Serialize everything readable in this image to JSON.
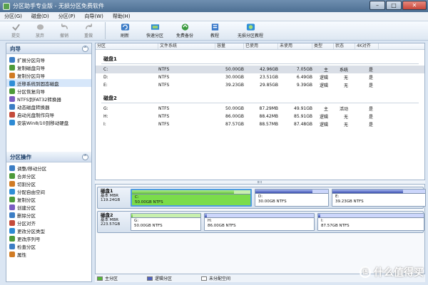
{
  "window": {
    "title": "分区助手专业版 - 无损分区免费软件"
  },
  "menu": [
    "分区(G)",
    "磁盘(D)",
    "分区(P)",
    "向导(W)",
    "帮助(H)"
  ],
  "toolbar": [
    {
      "label": "提交",
      "icon": "check-icon",
      "enabled": false
    },
    {
      "label": "放弃",
      "icon": "discard-icon",
      "enabled": false
    },
    {
      "label": "撤销",
      "icon": "undo-icon",
      "enabled": false
    },
    {
      "label": "重做",
      "icon": "redo-icon",
      "enabled": false
    },
    {
      "label": "刷新",
      "icon": "refresh-icon",
      "enabled": true
    },
    {
      "label": "快速分区",
      "icon": "quick-partition-icon",
      "enabled": true
    },
    {
      "label": "免费备份",
      "icon": "backup-icon",
      "enabled": true
    },
    {
      "label": "教程",
      "icon": "tutorial-icon",
      "enabled": true
    },
    {
      "label": "无损分区教程",
      "icon": "tutorial-icon",
      "enabled": true
    }
  ],
  "sidebar": {
    "wizard_title": "向导",
    "wizard_items": [
      "扩展分区向导",
      "复制磁盘向导",
      "复制分区向导",
      "迁移系统到固态磁盘",
      "分区恢复向导",
      "NTFS到FAT32转换器",
      "动态磁盘转换器",
      "启动光盘制作向导",
      "安装Win8/10到移动硬盘"
    ],
    "ops_title": "分区操作",
    "ops_items": [
      "调整/移动分区",
      "合并分区",
      "切割分区",
      "分配自由空间",
      "复制分区",
      "创建分区",
      "删除分区",
      "分区对齐",
      "更改分区类型",
      "更改序列号",
      "检查分区",
      "属性"
    ]
  },
  "table": {
    "headers": [
      "分区",
      "文件系统",
      "容量",
      "已使用",
      "未使用",
      "类型",
      "状态",
      "4K对齐"
    ],
    "disks": [
      {
        "name": "磁盘1",
        "rows": [
          [
            "C:",
            "NTFS",
            "50.00GB",
            "42.96GB",
            "7.05GB",
            "主",
            "系统",
            "是"
          ],
          [
            "D:",
            "NTFS",
            "30.00GB",
            "23.51GB",
            "6.49GB",
            "逻辑",
            "无",
            "是"
          ],
          [
            "E:",
            "NTFS",
            "39.23GB",
            "29.85GB",
            "9.39GB",
            "逻辑",
            "无",
            "是"
          ]
        ]
      },
      {
        "name": "磁盘2",
        "rows": [
          [
            "G:",
            "NTFS",
            "50.00GB",
            "87.29MB",
            "49.91GB",
            "主",
            "活动",
            "是"
          ],
          [
            "H:",
            "NTFS",
            "86.00GB",
            "88.42MB",
            "85.91GB",
            "逻辑",
            "无",
            "是"
          ],
          [
            "I:",
            "NTFS",
            "87.57GB",
            "88.57MB",
            "87.48GB",
            "逻辑",
            "无",
            "是"
          ]
        ]
      }
    ]
  },
  "diskmap": [
    {
      "name": "磁盘1",
      "info1": "基本 MBR",
      "info2": "119.24GB",
      "parts": [
        {
          "letter": "C:",
          "desc": "50.00GB NTFS",
          "fill": 0.86
        },
        {
          "letter": "D:",
          "desc": "30.00GB NTFS",
          "fill": 0.78
        },
        {
          "letter": "E:",
          "desc": "39.23GB NTFS",
          "fill": 0.76
        }
      ]
    },
    {
      "name": "磁盘2",
      "info1": "基本 MBR",
      "info2": "223.57GB",
      "parts": [
        {
          "letter": "G:",
          "desc": "50.00GB NTFS",
          "fill": 0.02
        },
        {
          "letter": "H:",
          "desc": "86.00GB NTFS",
          "fill": 0.02
        },
        {
          "letter": "I:",
          "desc": "87.57GB NTFS",
          "fill": 0.02
        }
      ]
    }
  ],
  "legend": [
    "主分区",
    "逻辑分区",
    "未分配空间"
  ],
  "watermark": "什么值得买",
  "watermark_badge": "值",
  "colors": {
    "primary": "#57b736",
    "logical": "#5062c0",
    "unallocated": "#ffffff"
  }
}
